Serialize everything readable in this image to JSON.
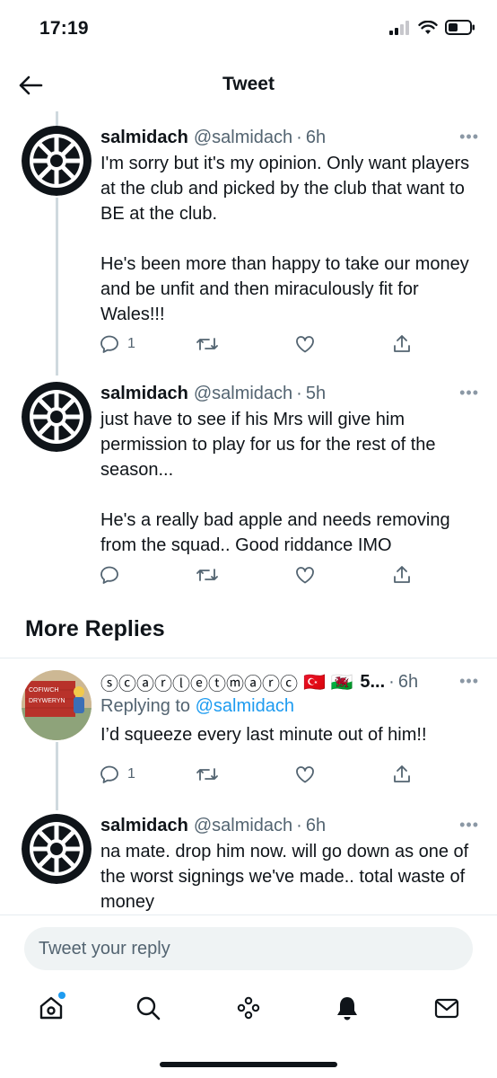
{
  "status_bar": {
    "time": "17:19"
  },
  "nav": {
    "title": "Tweet",
    "back_icon": "arrow-left-icon"
  },
  "tweets": [
    {
      "name": "salmidach",
      "handle": "@salmidach",
      "time": "6h",
      "text": "I'm sorry but it's my opinion. Only want players at the club and picked by the club that want to BE at the club.\n\nHe's been more than happy to take our money and be unfit and then miraculously fit for Wales!!!",
      "reply_count": "1"
    },
    {
      "name": "salmidach",
      "handle": "@salmidach",
      "time": "5h",
      "text": "just have to see if his Mrs will give him permission to play for us for the rest of the season...\n\nHe's a really bad apple and needs removing from the squad.. Good riddance IMO",
      "reply_count": ""
    }
  ],
  "more_replies": {
    "title": "More Replies",
    "tweets": [
      {
        "name": "ⓢⓒⓐⓡⓛⓔⓣⓜⓐⓡⓒ",
        "flags": "🇹🇷 🏴󠁧󠁢󠁷󠁬󠁳󠁿",
        "handle": "5...",
        "time": "6h",
        "replying_prefix": "Replying to",
        "replying_to": "@salmidach",
        "text": "I’d squeeze every last minute out of him!!",
        "reply_count": "1",
        "avatar_sign_line1": "COFIWCH",
        "avatar_sign_line2": "DRYWERYN"
      },
      {
        "name": "salmidach",
        "handle": "@salmidach",
        "time": "6h",
        "text": "na mate. drop him now. will go down as one of the worst signings we've made.. total waste of money"
      }
    ]
  },
  "compose": {
    "placeholder": "Tweet your reply"
  },
  "tab_bar": {
    "items": [
      "home-icon",
      "search-icon",
      "spaces-icon",
      "notifications-icon",
      "messages-icon"
    ]
  }
}
